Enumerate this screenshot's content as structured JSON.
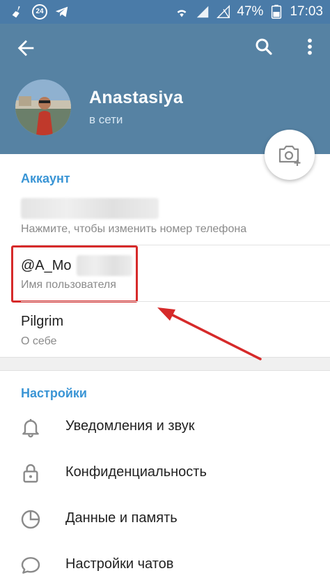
{
  "status_bar": {
    "notification_count": "24",
    "battery_percent": "47%",
    "time": "17:03"
  },
  "profile": {
    "name": "Anastasiya",
    "status": "в сети"
  },
  "account": {
    "section_title": "Аккаунт",
    "phone_hint": "Нажмите, чтобы изменить номер телефона",
    "username_value": "@A_Mo",
    "username_label": "Имя пользователя",
    "bio_value": "Pilgrim",
    "bio_label": "О себе"
  },
  "settings": {
    "section_title": "Настройки",
    "items": [
      {
        "label": "Уведомления и звук",
        "icon": "bell-icon"
      },
      {
        "label": "Конфиденциальность",
        "icon": "lock-icon"
      },
      {
        "label": "Данные и память",
        "icon": "pie-chart-icon"
      },
      {
        "label": "Настройки чатов",
        "icon": "chat-bubble-icon"
      }
    ]
  },
  "colors": {
    "header": "#5682a3",
    "status_bar": "#4a7ba8",
    "accent": "#3a95d5",
    "highlight": "#d62a2a"
  }
}
